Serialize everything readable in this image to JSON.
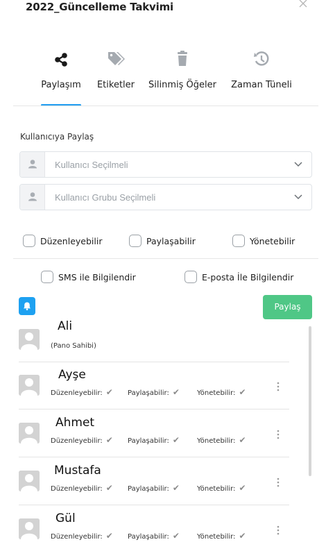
{
  "dialog": {
    "title": "2022_Güncelleme Takvimi",
    "close_icon": "close-icon"
  },
  "tabs": [
    {
      "label": "Paylaşım",
      "icon": "share-icon",
      "active": true
    },
    {
      "label": "Etiketler",
      "icon": "tags-icon",
      "active": false
    },
    {
      "label": "Silinmiş Öğeler",
      "icon": "trash-icon",
      "active": false
    },
    {
      "label": "Zaman Tüneli",
      "icon": "history-icon",
      "active": false
    }
  ],
  "share_section": {
    "label": "Kullanıcıya Paylaş",
    "user_select_placeholder": "Kullanıcı Seçilmeli",
    "group_select_placeholder": "Kullanıcı Grubu Seçilmeli"
  },
  "permissions": {
    "editable": "Düzenleyebilir",
    "shareable": "Paylaşabilir",
    "manageable": "Yönetebilir"
  },
  "notifications": {
    "sms": "SMS ile Bilgilendir",
    "email": "E-posta İle Bilgilendir"
  },
  "actions": {
    "share_label": "Paylaş"
  },
  "users": [
    {
      "name": "Ali",
      "owner_note": "(Pano Sahibi)"
    },
    {
      "name": "Ayşe",
      "perm_edit": "Düzenleyebilir:",
      "perm_share": "Paylaşabilir:",
      "perm_manage": "Yönetebilir:"
    },
    {
      "name": "Ahmet",
      "perm_edit": "Düzenleyebilir:",
      "perm_share": "Paylaşabilir:",
      "perm_manage": "Yönetebilir:"
    },
    {
      "name": "Mustafa",
      "perm_edit": "Düzenleyebilir:",
      "perm_share": "Paylaşabilir:",
      "perm_manage": "Yönetebilir:"
    },
    {
      "name": "Gül",
      "perm_edit": "Düzenleyebilir:",
      "perm_share": "Paylaşabilir:",
      "perm_manage": "Yönetebilir:"
    }
  ],
  "colors": {
    "accent": "#1e9cf0",
    "share_button": "#4fc786",
    "icon_gray": "#9aa0a6"
  }
}
